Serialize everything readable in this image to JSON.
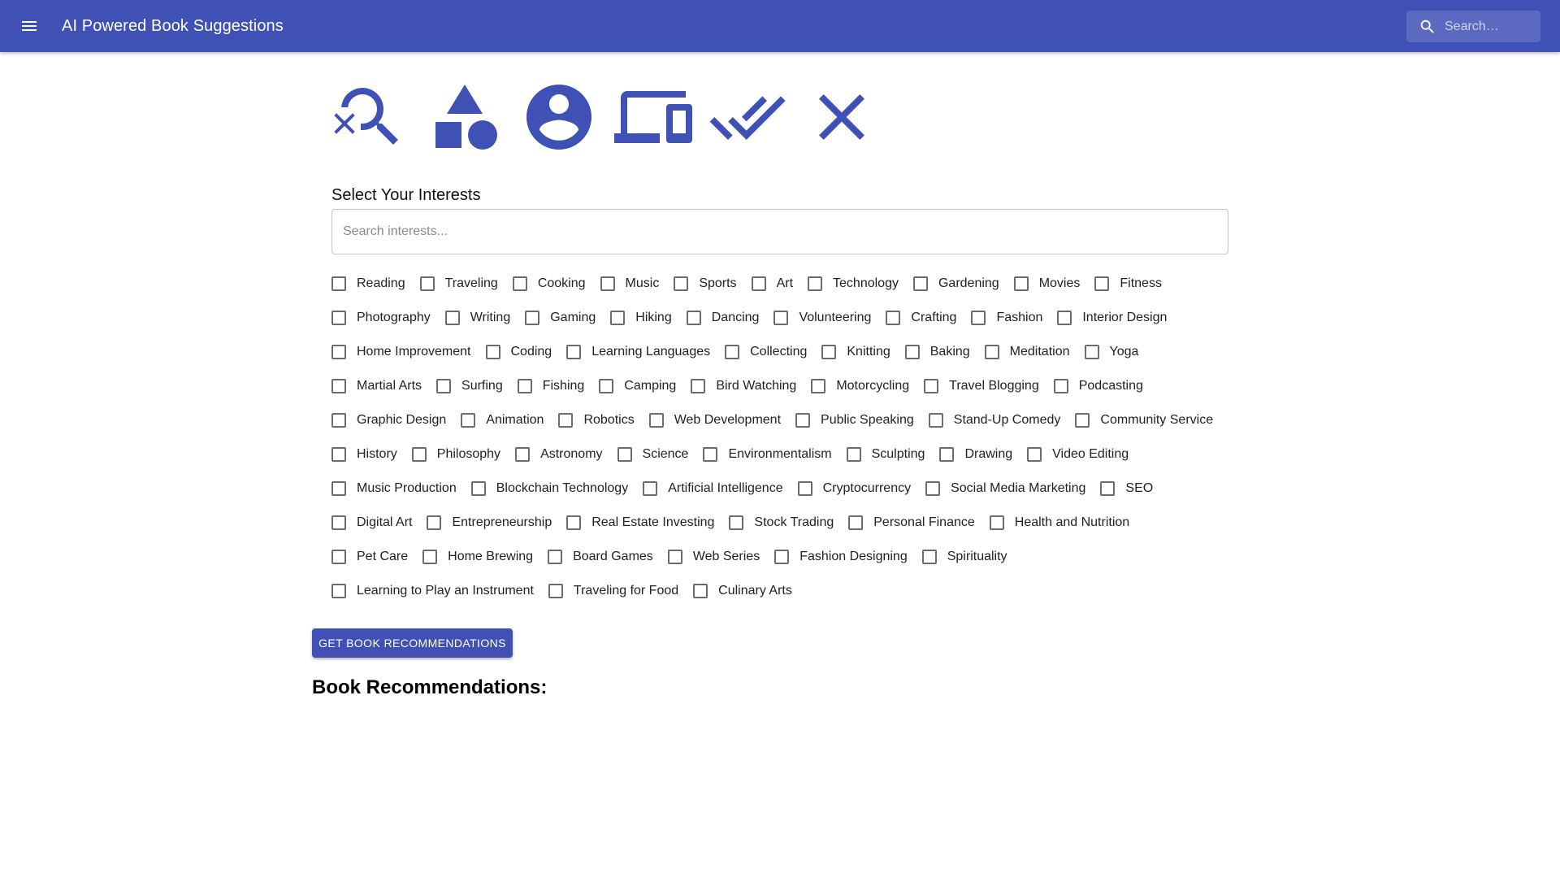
{
  "appbar": {
    "title": "AI Powered Book Suggestions",
    "menu_icon": "menu-icon",
    "search_placeholder": "Search…",
    "search_icon": "search-icon",
    "color": "#3f51b5"
  },
  "hero_icons": [
    "manage-search-icon",
    "category-icon",
    "account-circle-icon",
    "devices-icon",
    "done-all-icon",
    "close-icon"
  ],
  "interests": {
    "label": "Select Your Interests",
    "search_placeholder": "Search interests...",
    "options": [
      "Reading",
      "Traveling",
      "Cooking",
      "Music",
      "Sports",
      "Art",
      "Technology",
      "Gardening",
      "Movies",
      "Fitness",
      "Photography",
      "Writing",
      "Gaming",
      "Hiking",
      "Dancing",
      "Volunteering",
      "Crafting",
      "Fashion",
      "Interior Design",
      "Home Improvement",
      "Coding",
      "Learning Languages",
      "Collecting",
      "Knitting",
      "Baking",
      "Meditation",
      "Yoga",
      "Martial Arts",
      "Surfing",
      "Fishing",
      "Camping",
      "Bird Watching",
      "Motorcycling",
      "Travel Blogging",
      "Podcasting",
      "Graphic Design",
      "Animation",
      "Robotics",
      "Web Development",
      "Public Speaking",
      "Stand-Up Comedy",
      "Community Service",
      "History",
      "Philosophy",
      "Astronomy",
      "Science",
      "Environmentalism",
      "Sculpting",
      "Drawing",
      "Video Editing",
      "Music Production",
      "Blockchain Technology",
      "Artificial Intelligence",
      "Cryptocurrency",
      "Social Media Marketing",
      "SEO",
      "Digital Art",
      "Entrepreneurship",
      "Real Estate Investing",
      "Stock Trading",
      "Personal Finance",
      "Health and Nutrition",
      "Pet Care",
      "Home Brewing",
      "Board Games",
      "Web Series",
      "Fashion Designing",
      "Spirituality",
      "Learning to Play an Instrument",
      "Traveling for Food",
      "Culinary Arts"
    ]
  },
  "actions": {
    "recommend_label": "GET BOOK RECOMMENDATIONS"
  },
  "results": {
    "heading": "Book Recommendations:"
  }
}
